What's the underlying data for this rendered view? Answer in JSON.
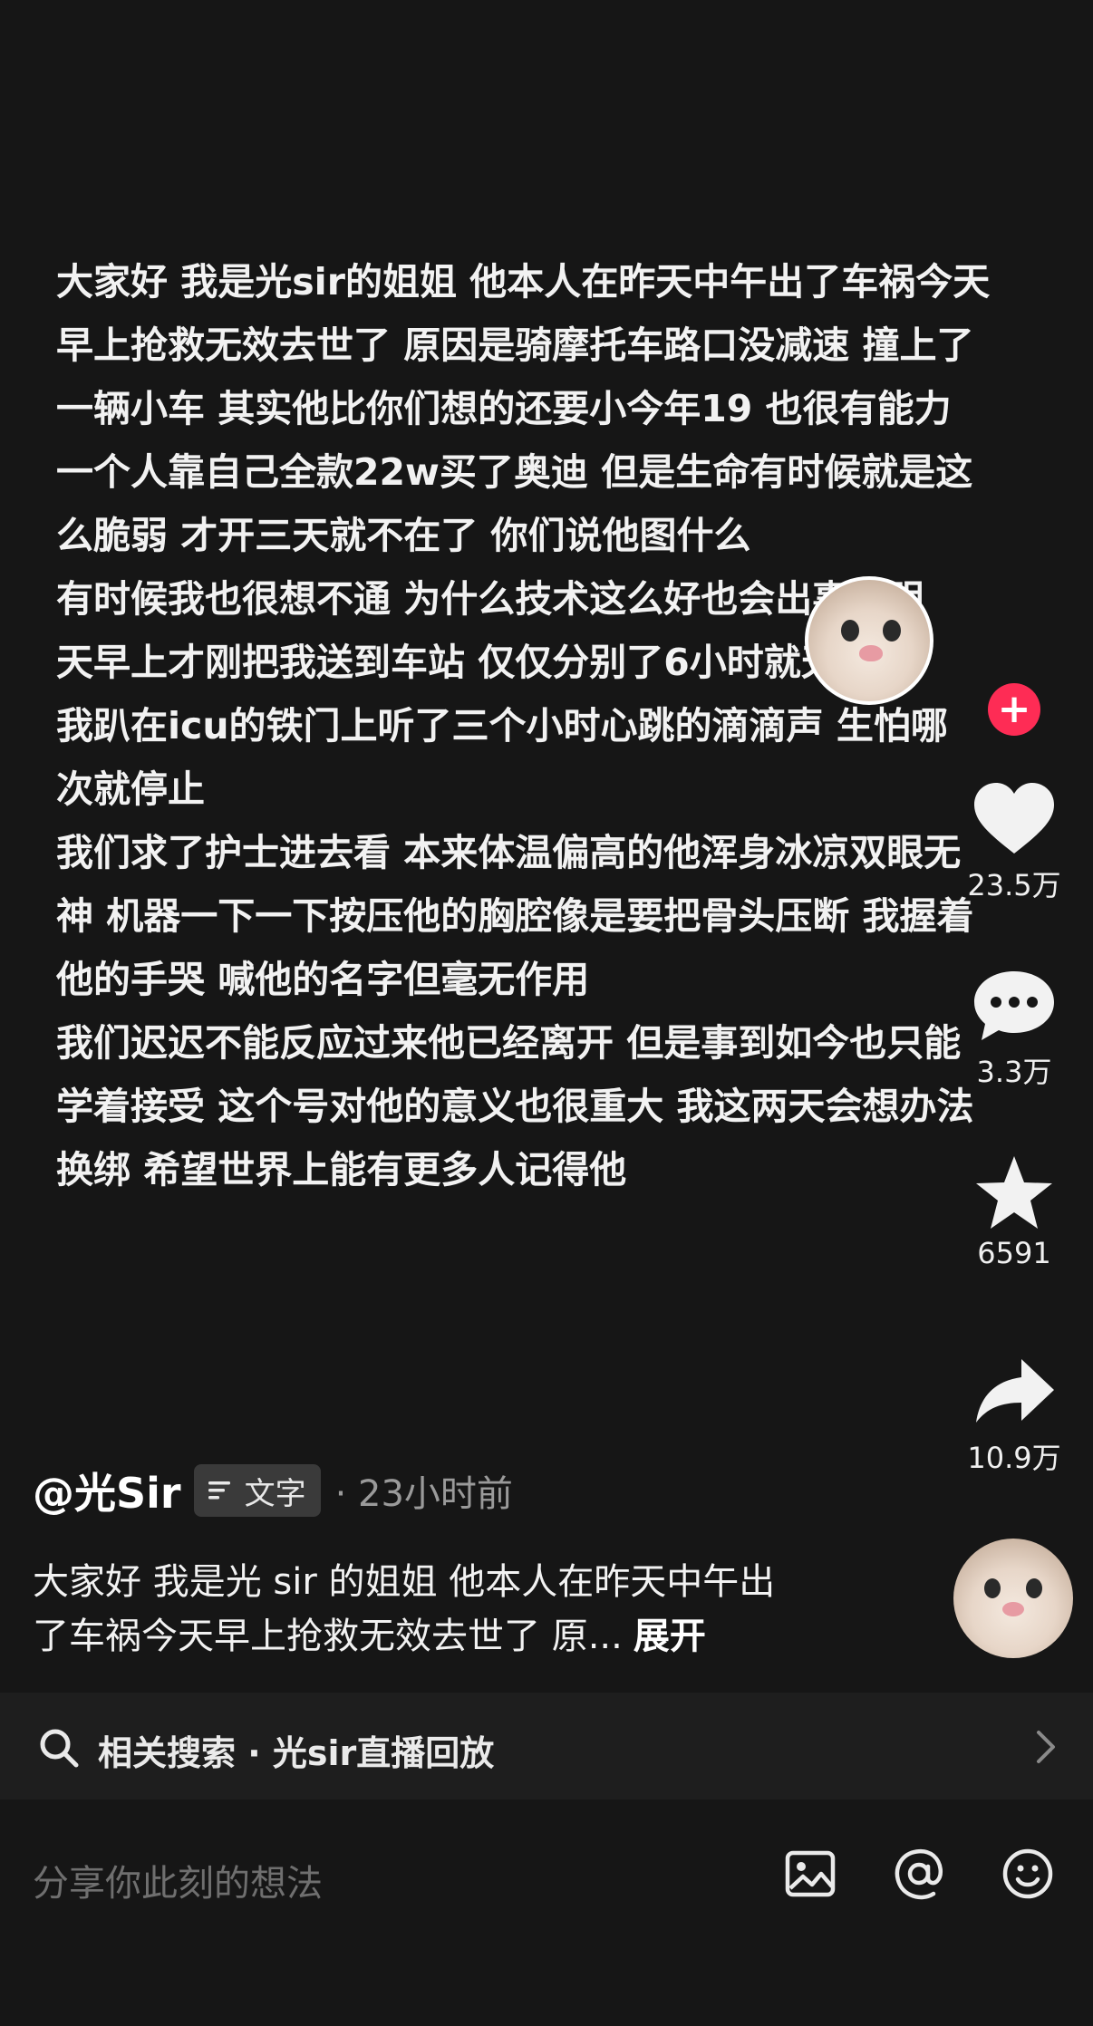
{
  "post": {
    "lines": [
      "大家好 我是光sir的姐姐 他本人在昨天中午出了车祸今天",
      "早上抢救无效去世了 原因是骑摩托车路口没减速 撞上了",
      "一辆小车 其实他比你们想的还要小今年19 也很有能力",
      "一个人靠自己全款22w买了奥迪 但是生命有时候就是这",
      "么脆弱 才开三天就不在了 你们说他图什么",
      "有时候我也很想不通 为什么技术这么好也会出事明明",
      "天早上才刚把我送到车站 仅仅分别了6小时就天人永",
      "我趴在icu的铁门上听了三个小时心跳的滴滴声 生怕哪",
      "次就停止",
      "我们求了护士进去看 本来体温偏高的他浑身冰凉双眼无",
      "神 机器一下一下按压他的胸腔像是要把骨头压断 我握着",
      "他的手哭 喊他的名字但毫无作用",
      "我们迟迟不能反应过来他已经离开 但是事到如今也只能",
      "学着接受 这个号对他的意义也很重大 我这两天会想办法",
      "换绑 希望世界上能有更多人记得他"
    ]
  },
  "rail": {
    "follow": "+",
    "like_count": "23.5万",
    "comment_count": "3.3万",
    "favorite_count": "6591",
    "share_count": "10.9万"
  },
  "author": {
    "name": "@光Sir",
    "tag": "文字",
    "time": "· 23小时前"
  },
  "caption": {
    "line1": "大家好 我是光 sir 的姐姐 他本人在昨天中午出",
    "line2": "了车祸今天早上抢救无效去世了 原...",
    "expand": "展开"
  },
  "related": {
    "text": "相关搜索 · 光sir直播回放"
  },
  "comment": {
    "placeholder": "分享你此刻的想法"
  },
  "colors": {
    "background": "#161616",
    "accent_follow": "#fe2c55"
  }
}
